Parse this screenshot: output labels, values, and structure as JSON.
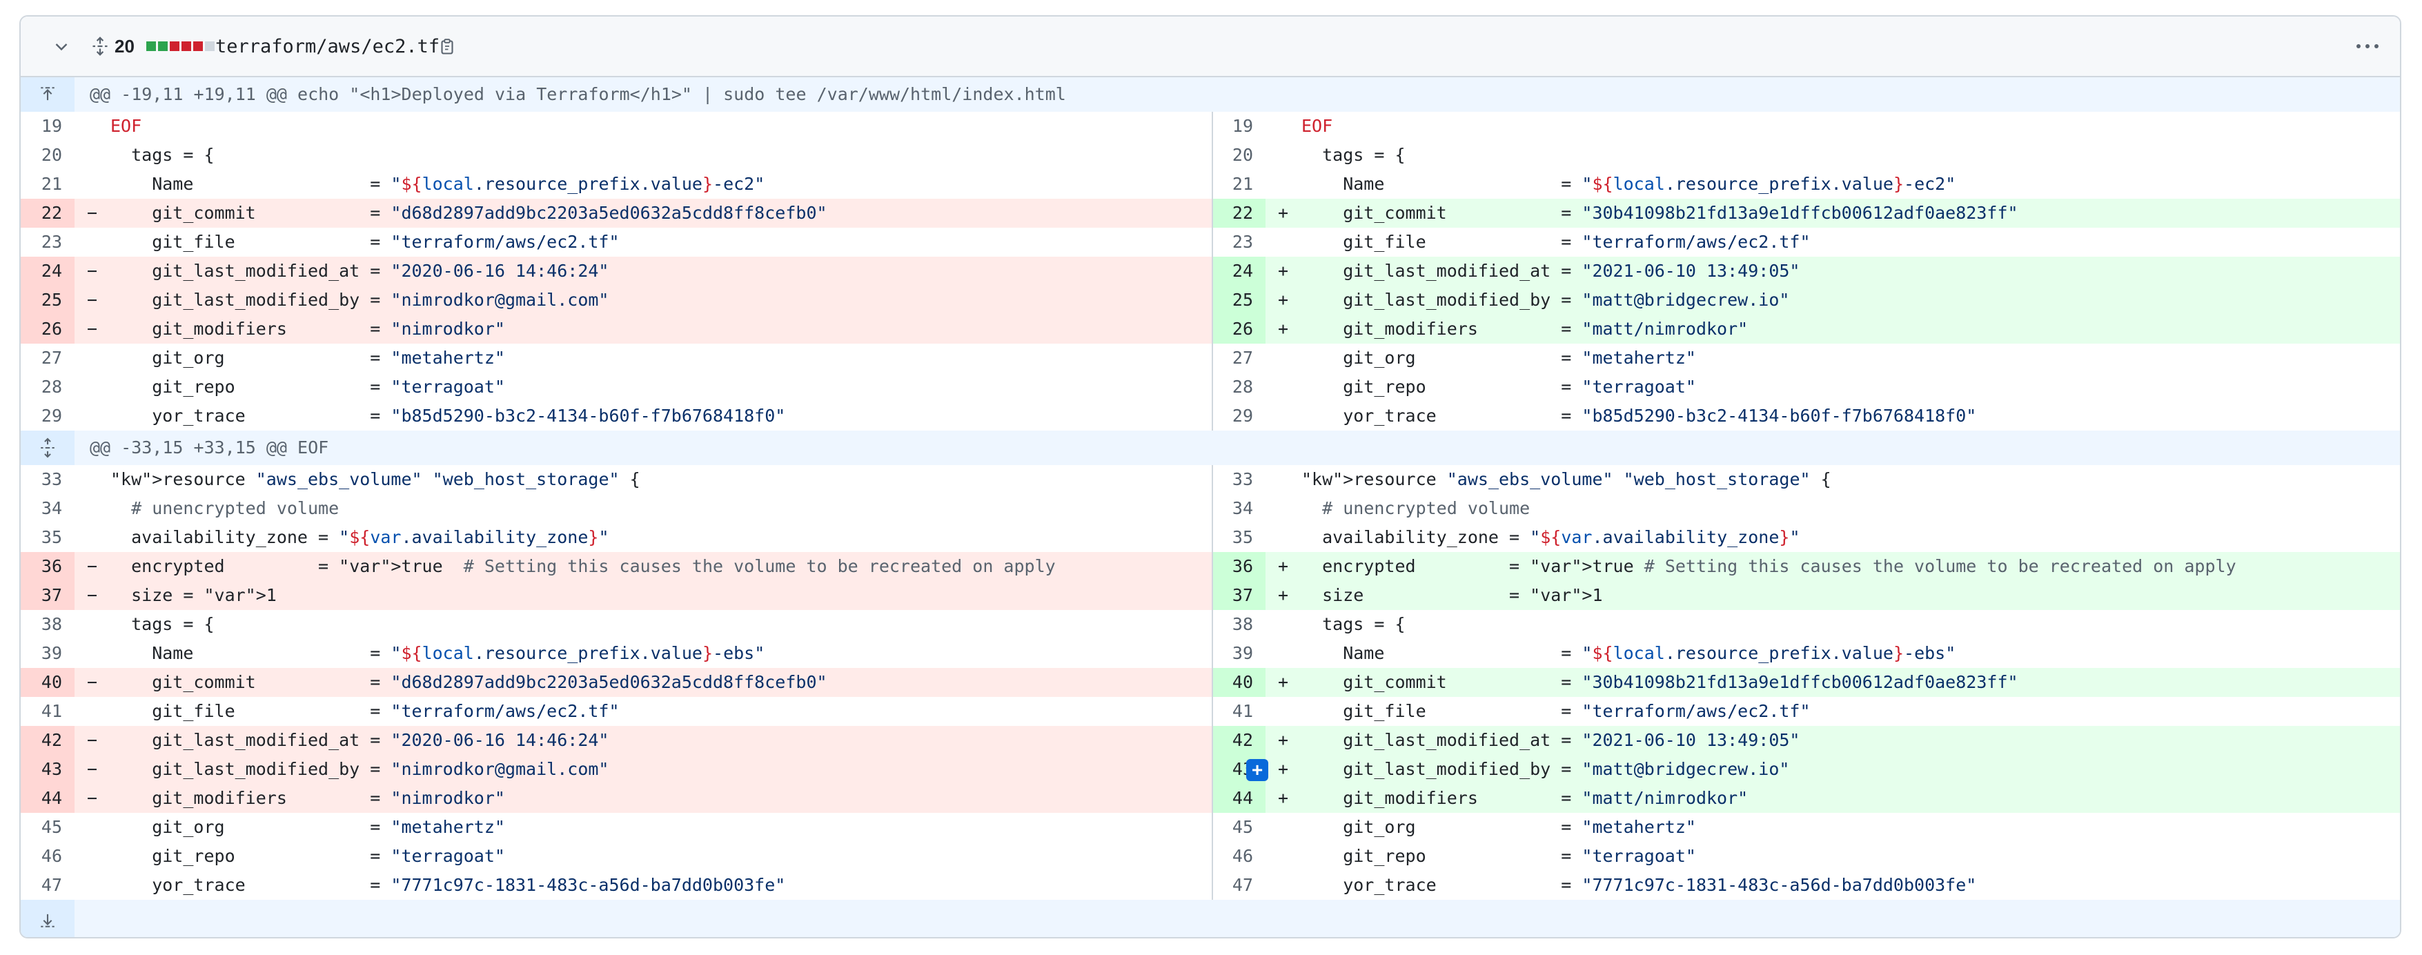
{
  "file": {
    "name": "terraform/aws/ec2.tf",
    "changes": "20",
    "diffstat": [
      "#2da44e",
      "#2da44e",
      "#cf222e",
      "#cf222e",
      "#cf222e",
      "#d0d7de"
    ]
  },
  "hunks": [
    "@@ -19,11 +19,11 @@ echo \"<h1>Deployed via Terraform</h1>\" | sudo tee /var/www/html/index.html",
    "@@ -33,15 +33,15 @@ EOF"
  ],
  "rows": [
    {
      "kind": "hunk",
      "hunk": 0
    },
    {
      "kind": "ctx",
      "l": "19",
      "r": "19"
    },
    {
      "kind": "ctx",
      "l": "20",
      "r": "20"
    },
    {
      "kind": "ctx",
      "l": "21",
      "r": "21"
    },
    {
      "kind": "chg",
      "l": "22",
      "r": "22"
    },
    {
      "kind": "ctx",
      "l": "23",
      "r": "23"
    },
    {
      "kind": "chg",
      "l": "24",
      "r": "24"
    },
    {
      "kind": "chg",
      "l": "25",
      "r": "25"
    },
    {
      "kind": "chg",
      "l": "26",
      "r": "26"
    },
    {
      "kind": "ctx",
      "l": "27",
      "r": "27"
    },
    {
      "kind": "ctx",
      "l": "28",
      "r": "28"
    },
    {
      "kind": "ctx",
      "l": "29",
      "r": "29"
    },
    {
      "kind": "hunk",
      "hunk": 1
    },
    {
      "kind": "ctx",
      "l": "33",
      "r": "33"
    },
    {
      "kind": "ctx",
      "l": "34",
      "r": "34"
    },
    {
      "kind": "ctx",
      "l": "35",
      "r": "35"
    },
    {
      "kind": "chg",
      "l": "36",
      "r": "36"
    },
    {
      "kind": "chg",
      "l": "37",
      "r": "37"
    },
    {
      "kind": "ctx",
      "l": "38",
      "r": "38"
    },
    {
      "kind": "ctx",
      "l": "39",
      "r": "39"
    },
    {
      "kind": "chg",
      "l": "40",
      "r": "40"
    },
    {
      "kind": "ctx",
      "l": "41",
      "r": "41"
    },
    {
      "kind": "chg",
      "l": "42",
      "r": "42"
    },
    {
      "kind": "chg",
      "l": "43",
      "r": "43"
    },
    {
      "kind": "chg",
      "l": "44",
      "r": "44"
    },
    {
      "kind": "ctx",
      "l": "45",
      "r": "45"
    },
    {
      "kind": "ctx",
      "l": "46",
      "r": "46"
    },
    {
      "kind": "ctx",
      "l": "47",
      "r": "47"
    }
  ],
  "code": {
    "left": {
      "19": "EOF",
      "20": "  tags = {",
      "21": "    Name                 = \"${local.resource_prefix.value}-ec2\"",
      "22": "    git_commit           = \"d68d2897add9bc2203a5ed0632a5cdd8ff8cefb0\"",
      "23": "    git_file             = \"terraform/aws/ec2.tf\"",
      "24": "    git_last_modified_at = \"2020-06-16 14:46:24\"",
      "25": "    git_last_modified_by = \"nimrodkor@gmail.com\"",
      "26": "    git_modifiers        = \"nimrodkor\"",
      "27": "    git_org              = \"metahertz\"",
      "28": "    git_repo             = \"terragoat\"",
      "29": "    yor_trace            = \"b85d5290-b3c2-4134-b60f-f7b6768418f0\"",
      "33": "resource \"aws_ebs_volume\" \"web_host_storage\" {",
      "34": "  # unencrypted volume",
      "35": "  availability_zone = \"${var.availability_zone}\"",
      "36": "  encrypted         = true  # Setting this causes the volume to be recreated on apply",
      "37": "  size = 1",
      "38": "  tags = {",
      "39": "    Name                 = \"${local.resource_prefix.value}-ebs\"",
      "40": "    git_commit           = \"d68d2897add9bc2203a5ed0632a5cdd8ff8cefb0\"",
      "41": "    git_file             = \"terraform/aws/ec2.tf\"",
      "42": "    git_last_modified_at = \"2020-06-16 14:46:24\"",
      "43": "    git_last_modified_by = \"nimrodkor@gmail.com\"",
      "44": "    git_modifiers        = \"nimrodkor\"",
      "45": "    git_org              = \"metahertz\"",
      "46": "    git_repo             = \"terragoat\"",
      "47": "    yor_trace            = \"7771c97c-1831-483c-a56d-ba7dd0b003fe\""
    },
    "right": {
      "19": "EOF",
      "20": "  tags = {",
      "21": "    Name                 = \"${local.resource_prefix.value}-ec2\"",
      "22": "    git_commit           = \"30b41098b21fd13a9e1dffcb00612adf0ae823ff\"",
      "23": "    git_file             = \"terraform/aws/ec2.tf\"",
      "24": "    git_last_modified_at = \"2021-06-10 13:49:05\"",
      "25": "    git_last_modified_by = \"matt@bridgecrew.io\"",
      "26": "    git_modifiers        = \"matt/nimrodkor\"",
      "27": "    git_org              = \"metahertz\"",
      "28": "    git_repo             = \"terragoat\"",
      "29": "    yor_trace            = \"b85d5290-b3c2-4134-b60f-f7b6768418f0\"",
      "33": "resource \"aws_ebs_volume\" \"web_host_storage\" {",
      "34": "  # unencrypted volume",
      "35": "  availability_zone = \"${var.availability_zone}\"",
      "36": "  encrypted         = true # Setting this causes the volume to be recreated on apply",
      "37": "  size              = 1",
      "38": "  tags = {",
      "39": "    Name                 = \"${local.resource_prefix.value}-ebs\"",
      "40": "    git_commit           = \"30b41098b21fd13a9e1dffcb00612adf0ae823ff\"",
      "41": "    git_file             = \"terraform/aws/ec2.tf\"",
      "42": "    git_last_modified_at = \"2021-06-10 13:49:05\"",
      "43": "    git_last_modified_by = \"matt@bridgecrew.io\"",
      "44": "    git_modifiers        = \"matt/nimrodkor\"",
      "45": "    git_org              = \"metahertz\"",
      "46": "    git_repo             = \"terragoat\"",
      "47": "    yor_trace            = \"7771c97c-1831-483c-a56d-ba7dd0b003fe\""
    }
  },
  "add_comment_line": "43"
}
